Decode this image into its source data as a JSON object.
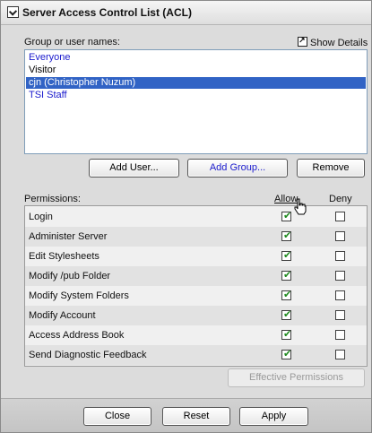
{
  "window": {
    "title": "Server Access Control List (ACL)"
  },
  "groups": {
    "label": "Group or user names:",
    "show_details": "Show Details",
    "items": [
      {
        "name": "Everyone",
        "state": "blue"
      },
      {
        "name": "Visitor",
        "state": "black"
      },
      {
        "name": "cjn (Christopher Nuzum)",
        "state": "selected"
      },
      {
        "name": "TSI Staff",
        "state": "blue"
      }
    ],
    "buttons": {
      "add_user": "Add User...",
      "add_group": "Add Group...",
      "remove": "Remove"
    }
  },
  "permissions": {
    "label": "Permissions:",
    "allow_header": "Allow",
    "deny_header": "Deny",
    "rows": [
      {
        "name": "Login",
        "allow": true,
        "deny": false
      },
      {
        "name": "Administer Server",
        "allow": true,
        "deny": false
      },
      {
        "name": "Edit Stylesheets",
        "allow": true,
        "deny": false
      },
      {
        "name": "Modify /pub Folder",
        "allow": true,
        "deny": false
      },
      {
        "name": "Modify System Folders",
        "allow": true,
        "deny": false
      },
      {
        "name": "Modify Account",
        "allow": true,
        "deny": false
      },
      {
        "name": "Access Address Book",
        "allow": true,
        "deny": false
      },
      {
        "name": "Send Diagnostic Feedback",
        "allow": true,
        "deny": false
      }
    ],
    "effective_button": "Effective Permissions"
  },
  "footer": {
    "close": "Close",
    "reset": "Reset",
    "apply": "Apply"
  },
  "colors": {
    "selection": "#3163c5",
    "link_text": "#1a1acd",
    "check": "#1e8a1e"
  }
}
